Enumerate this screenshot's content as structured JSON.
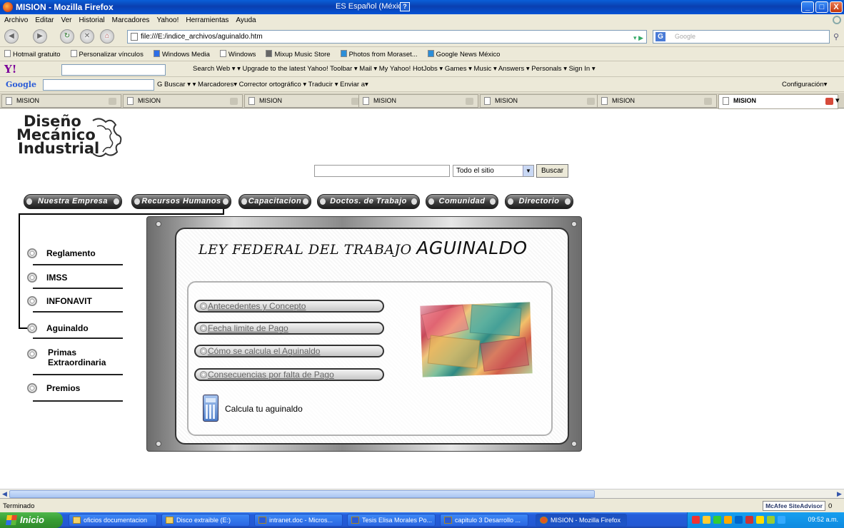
{
  "window": {
    "title": "MISION - Mozilla Firefox",
    "language": "ES Español (México)",
    "controls": {
      "minimize": "_",
      "maximize": "□",
      "close": "X"
    }
  },
  "menubar": [
    "Archivo",
    "Editar",
    "Ver",
    "Historial",
    "Marcadores",
    "Yahoo!",
    "Herramientas",
    "Ayuda"
  ],
  "navbar": {
    "url": "file:///E:/indice_archivos/aguinaldo.htm",
    "search_placeholder": "Google",
    "search_engine_letter": "G"
  },
  "bookmarks": [
    "Hotmail gratuito",
    "Personalizar vínculos",
    "Windows Media",
    "Windows",
    "Mixup Music Store",
    "Photos from Moraset...",
    "Google News México"
  ],
  "yahoo_toolbar": {
    "logo": "Y!",
    "items": "Search Web ▾   ▾   Upgrade to the latest Yahoo! Toolbar ▾   Mail ▾   My Yahoo!   HotJobs ▾   Games ▾   Music ▾   Answers ▾   Personals ▾   Sign In ▾"
  },
  "google_toolbar": {
    "logo": "Google",
    "items": "G Buscar ▾     ▾   Marcadores▾   Corrector ortográfico ▾   Traducir ▾   Enviar a▾",
    "config": "Configuración▾"
  },
  "tabs": [
    "MISION",
    "MISION",
    "MISION",
    "MISION",
    "MISION",
    "MISION",
    "MISION"
  ],
  "site": {
    "logo": [
      "Diseño",
      "Mecánico",
      "Industrial"
    ],
    "search": {
      "scope": "Todo el sitio",
      "button": "Buscar"
    },
    "topnav": [
      "Nuestra Empresa",
      "Recursos Humanos",
      "Capacitacion",
      "Doctos. de Trabajo",
      "Comunidad",
      "Directorio"
    ],
    "sidenav": [
      "Reglamento",
      "IMSS",
      "INFONAVIT",
      "Aguinaldo",
      "Primas Extraordinaria",
      "Premios"
    ],
    "panel": {
      "title_small": "LEY FEDERAL DEL TRABAJO",
      "title_big": "AGUINALDO",
      "links": [
        "Antecedentes y Concepto",
        "Fecha limite de Pago",
        "Cómo se calcula el Aguinaldo",
        "Consecuencias por falta de Pago"
      ],
      "calc_label": "Calcula tu aguinaldo"
    }
  },
  "statusbar": {
    "text": "Terminado",
    "mcafee": "McAfee SiteAdvisor ▾",
    "mcafee_count": "0"
  },
  "taskbar": {
    "start": "Inicio",
    "tasks": [
      "oficios documentacion",
      "Disco extraible (E:)",
      "intranet.doc - Micros...",
      "Tesis Elisa Morales Po...",
      "capitulo 3 Desarrollo ...",
      "MISION - Mozilla Firefox"
    ],
    "clock": "09:52 a.m."
  }
}
